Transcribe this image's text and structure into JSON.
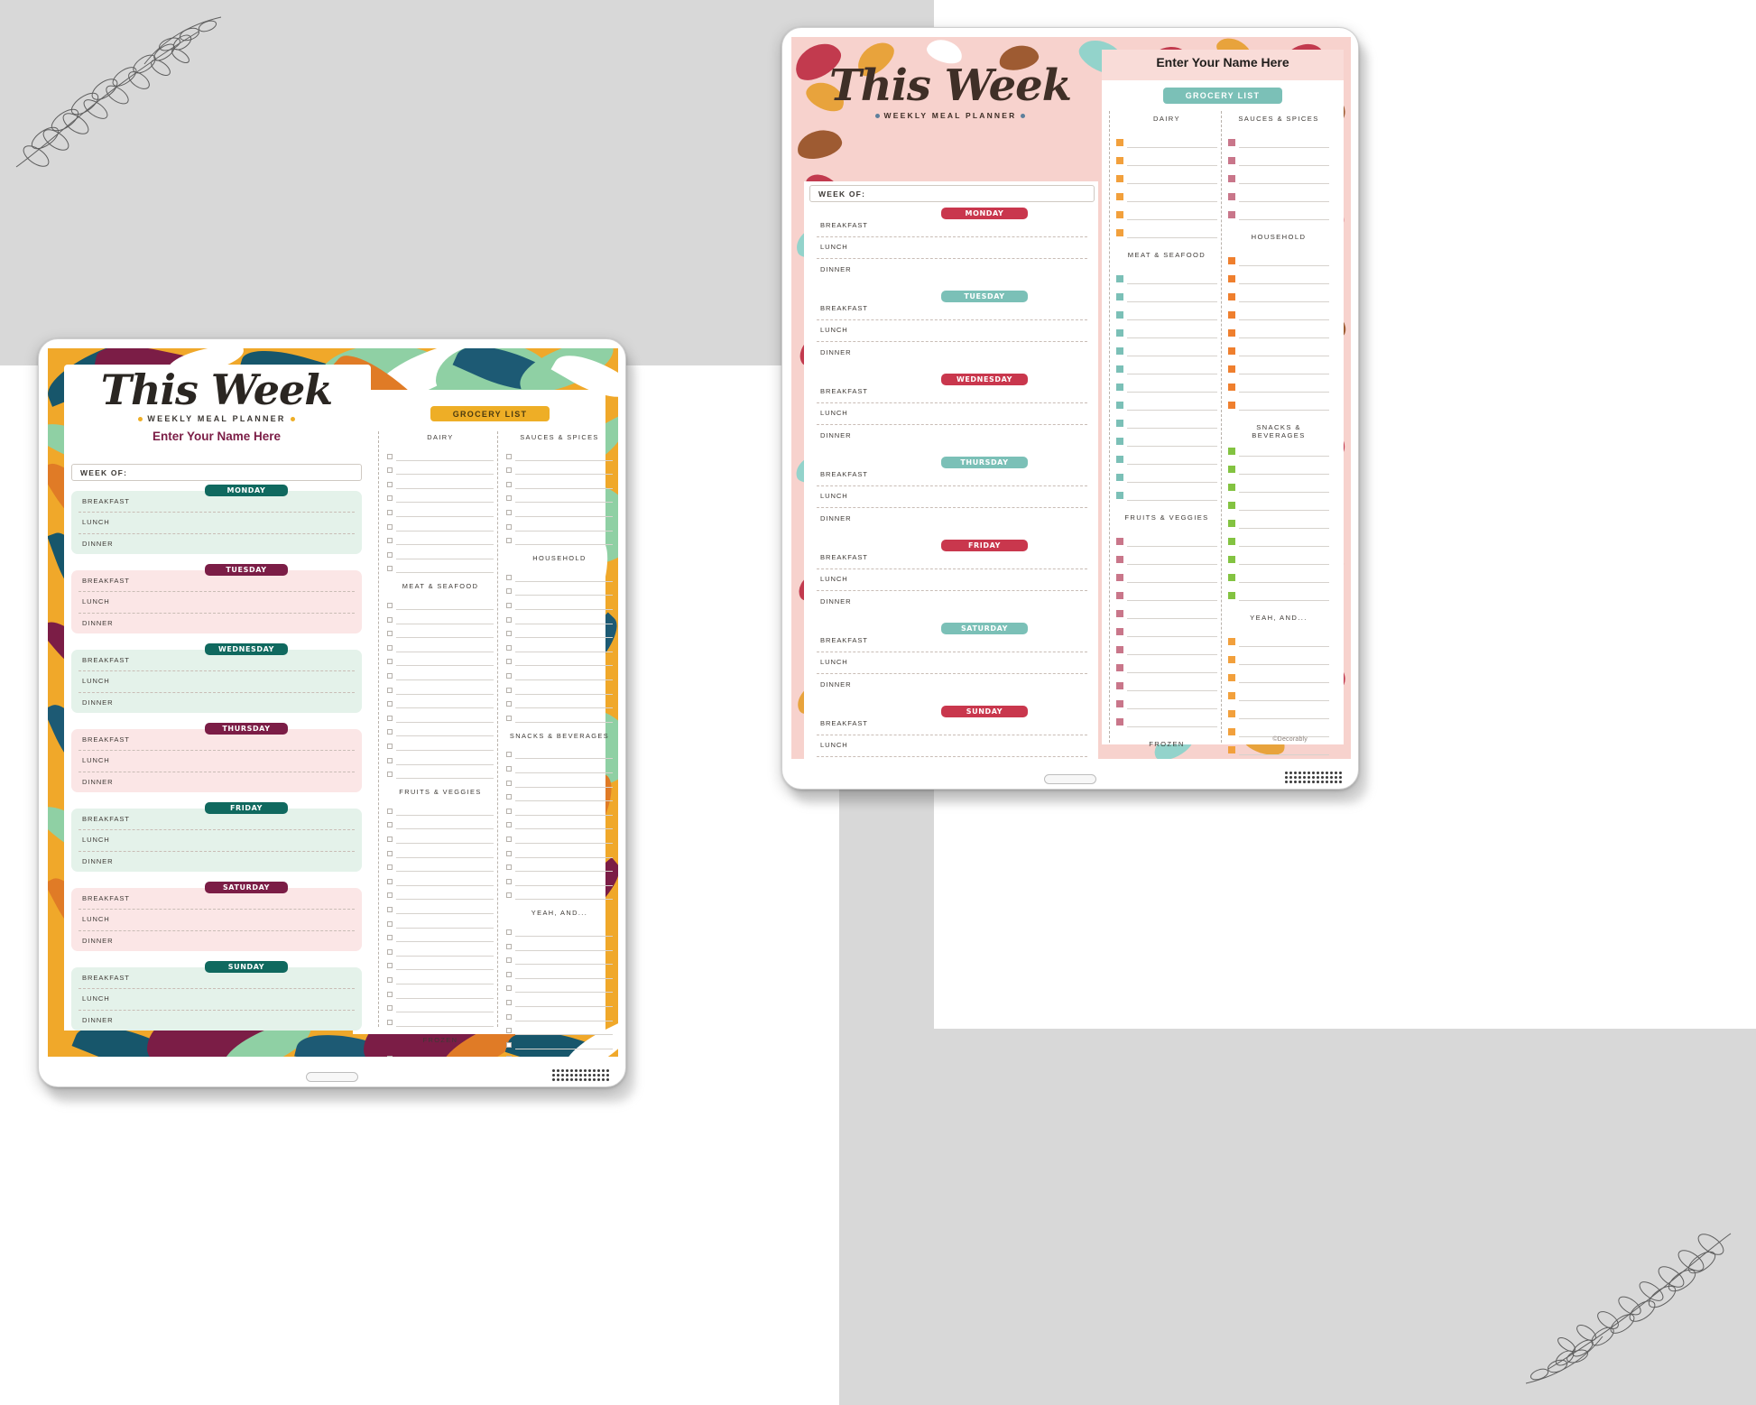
{
  "scene": {
    "background_color": "#d8d8d8",
    "white_panel_color": "#ffffff",
    "description": "Two tablet mockups showing a weekly meal planner printable"
  },
  "planner_left": {
    "theme": "tropical-leaves",
    "theme_colors": {
      "frame": "#efa92c",
      "leaf_teal": "#17566b",
      "leaf_maroon": "#7b1d46",
      "leaf_green": "#8fd0a4",
      "leaf_orange": "#e07b26",
      "badge_grocery": "#eeae26",
      "mint_block": "#e4f2ea",
      "pink_block": "#fbe6e6"
    },
    "title": "This Week",
    "subtitle": "WEEKLY MEAL PLANNER",
    "name_placeholder": "Enter Your Name Here",
    "week_of_label": "WEEK OF:",
    "meal_rows": [
      "BREAKFAST",
      "LUNCH",
      "DINNER"
    ],
    "days": [
      {
        "label": "MONDAY",
        "badge_color": "#10695f",
        "block_color": "#e4f2ea"
      },
      {
        "label": "TUESDAY",
        "badge_color": "#7b1d46",
        "block_color": "#fbe6e6"
      },
      {
        "label": "WEDNESDAY",
        "badge_color": "#10695f",
        "block_color": "#e4f2ea"
      },
      {
        "label": "THURSDAY",
        "badge_color": "#7b1d46",
        "block_color": "#fbe6e6"
      },
      {
        "label": "FRIDAY",
        "badge_color": "#10695f",
        "block_color": "#e4f2ea"
      },
      {
        "label": "SATURDAY",
        "badge_color": "#7b1d46",
        "block_color": "#fbe6e6"
      },
      {
        "label": "SUNDAY",
        "badge_color": "#10695f",
        "block_color": "#e4f2ea"
      }
    ],
    "grocery": {
      "badge_label": "GROCERY LIST",
      "badge_color": "#eeae26",
      "badge_text_color": "#4a3a10",
      "bullet_style": "empty-checkbox",
      "columns": [
        {
          "categories": [
            {
              "label": "DAIRY",
              "rows": 9
            },
            {
              "label": "MEAT & SEAFOOD",
              "rows": 13
            },
            {
              "label": "FRUITS & VEGGIES",
              "rows": 16
            },
            {
              "label": "FROZEN",
              "rows": 9
            }
          ]
        },
        {
          "categories": [
            {
              "label": "SAUCES & SPICES",
              "rows": 7
            },
            {
              "label": "HOUSEHOLD",
              "rows": 11
            },
            {
              "label": "SNACKS & BEVERAGES",
              "rows": 11
            },
            {
              "label": "YEAH, AND...",
              "rows": 19
            }
          ]
        }
      ]
    }
  },
  "planner_right": {
    "theme": "autumn-leaves-pink",
    "theme_colors": {
      "frame": "#f7d2cd",
      "leaf_red": "#c23a4e",
      "leaf_teal": "#93d3cb",
      "leaf_orange": "#e8a33c",
      "leaf_brown": "#9e5b32",
      "badge_grocery": "#7bc0b7",
      "name_band": "#f9dcd8"
    },
    "title": "This Week",
    "subtitle": "WEEKLY MEAL PLANNER",
    "name_placeholder": "Enter Your Name Here",
    "week_of_label": "WEEK OF:",
    "meal_rows": [
      "BREAKFAST",
      "LUNCH",
      "DINNER"
    ],
    "days": [
      {
        "label": "MONDAY",
        "badge_color": "#c9374d"
      },
      {
        "label": "TUESDAY",
        "badge_color": "#7bc0b7"
      },
      {
        "label": "WEDNESDAY",
        "badge_color": "#c9374d"
      },
      {
        "label": "THURSDAY",
        "badge_color": "#7bc0b7"
      },
      {
        "label": "FRIDAY",
        "badge_color": "#c9374d"
      },
      {
        "label": "SATURDAY",
        "badge_color": "#7bc0b7"
      },
      {
        "label": "SUNDAY",
        "badge_color": "#c9374d"
      }
    ],
    "grocery": {
      "badge_label": "GROCERY LIST",
      "badge_color": "#7bc0b7",
      "badge_text_color": "#ffffff",
      "bullet_style": "filled-square",
      "columns": [
        {
          "categories": [
            {
              "label": "DAIRY",
              "rows": 6,
              "bullet_color": "#f2a03c"
            },
            {
              "label": "MEAT & SEAFOOD",
              "rows": 13,
              "bullet_color": "#7bc0b7"
            },
            {
              "label": "FRUITS & VEGGIES",
              "rows": 11,
              "bullet_color": "#c9768a"
            },
            {
              "label": "FROZEN",
              "rows": 9,
              "bullet_color": "#83c341"
            }
          ]
        },
        {
          "categories": [
            {
              "label": "SAUCES & SPICES",
              "rows": 5,
              "bullet_color": "#c9768a"
            },
            {
              "label": "HOUSEHOLD",
              "rows": 9,
              "bullet_color": "#ef7f2e"
            },
            {
              "label": "SNACKS & BEVERAGES",
              "rows": 9,
              "bullet_color": "#83c341"
            },
            {
              "label": "YEAH, AND...",
              "rows": 15,
              "bullet_color": "#f2a03c"
            }
          ]
        }
      ]
    },
    "watermark": "©Decorably"
  }
}
